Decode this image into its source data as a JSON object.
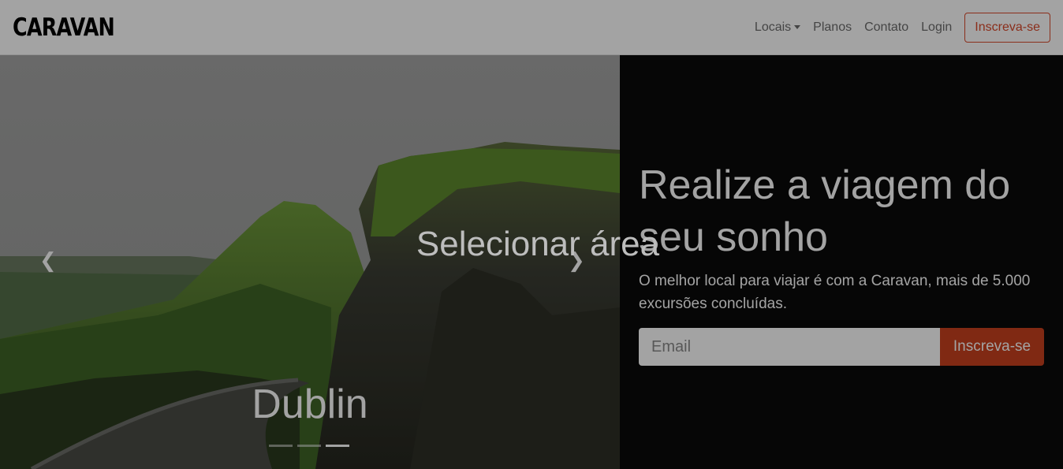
{
  "navbar": {
    "brand": "CARAVAN",
    "links": {
      "locais": "Locais",
      "planos": "Planos",
      "contato": "Contato",
      "login": "Login"
    },
    "signup_button": "Inscreva-se"
  },
  "carousel": {
    "caption": "Dublin",
    "prev_icon": "chevron-left-icon",
    "next_icon": "chevron-right-icon",
    "slides": 3,
    "active_index": 2
  },
  "hero": {
    "title": "Realize a viagem do seu sonho",
    "subtitle": "O melhor local para viajar é com a Caravan, mais de 5.000 excursões concluídas.",
    "email_placeholder": "Email",
    "submit_button": "Inscreva-se"
  },
  "overlay": {
    "label": "Selecionar área"
  },
  "colors": {
    "accent": "#d9492b",
    "hero_bg": "#0a0a0a"
  }
}
